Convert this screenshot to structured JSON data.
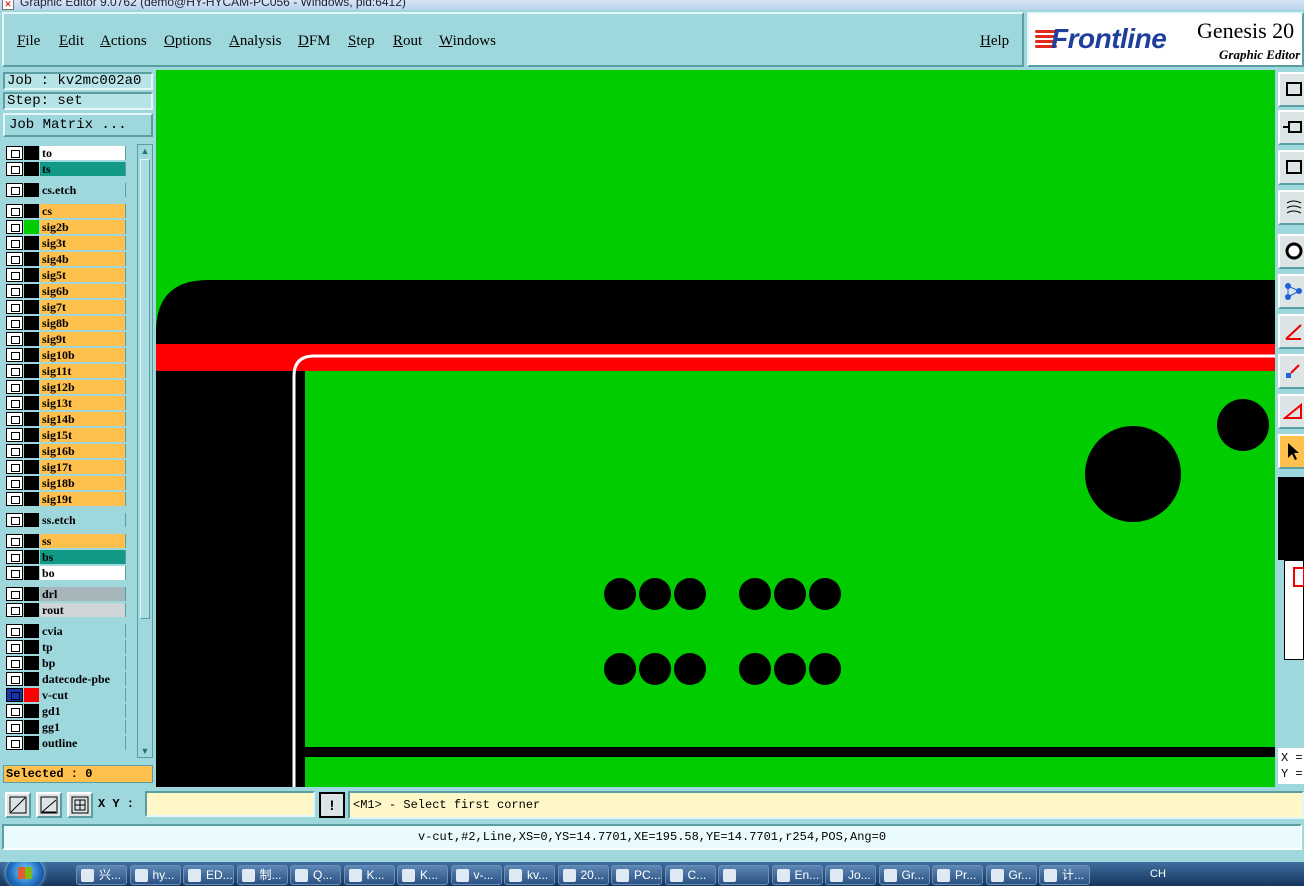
{
  "window": {
    "title": "Graphic Editor 9.0762 (demo@HY-HYCAM-PC056 - Windows, pid:6412)"
  },
  "menu": {
    "items": [
      "File",
      "Edit",
      "Actions",
      "Options",
      "Analysis",
      "DFM",
      "Step",
      "Rout",
      "Windows"
    ],
    "help": "Help"
  },
  "brand": {
    "logo": "Frontline",
    "product": "Genesis 20",
    "subtitle": "Graphic Editor"
  },
  "job": {
    "job_label": "Job : kv2mc002a0",
    "step_label": "Step: set",
    "matrix_button": "Job Matrix ..."
  },
  "layers": [
    {
      "name": "to",
      "color": "#ffffff",
      "sw": "#000000"
    },
    {
      "name": "ts",
      "color": "#129a86",
      "sw": "#000000"
    },
    {
      "name": "cs.etch",
      "color": "#9fd8dc",
      "sw": "#000000"
    },
    {
      "name": "cs",
      "color": "#ffc04d",
      "sw": "#000000"
    },
    {
      "name": "sig2b",
      "color": "#ffc04d",
      "sw": "#00cc00"
    },
    {
      "name": "sig3t",
      "color": "#ffc04d",
      "sw": "#000000"
    },
    {
      "name": "sig4b",
      "color": "#ffc04d",
      "sw": "#000000"
    },
    {
      "name": "sig5t",
      "color": "#ffc04d",
      "sw": "#000000"
    },
    {
      "name": "sig6b",
      "color": "#ffc04d",
      "sw": "#000000"
    },
    {
      "name": "sig7t",
      "color": "#ffc04d",
      "sw": "#000000"
    },
    {
      "name": "sig8b",
      "color": "#ffc04d",
      "sw": "#000000"
    },
    {
      "name": "sig9t",
      "color": "#ffc04d",
      "sw": "#000000"
    },
    {
      "name": "sig10b",
      "color": "#ffc04d",
      "sw": "#000000"
    },
    {
      "name": "sig11t",
      "color": "#ffc04d",
      "sw": "#000000"
    },
    {
      "name": "sig12b",
      "color": "#ffc04d",
      "sw": "#000000"
    },
    {
      "name": "sig13t",
      "color": "#ffc04d",
      "sw": "#000000"
    },
    {
      "name": "sig14b",
      "color": "#ffc04d",
      "sw": "#000000"
    },
    {
      "name": "sig15t",
      "color": "#ffc04d",
      "sw": "#000000"
    },
    {
      "name": "sig16b",
      "color": "#ffc04d",
      "sw": "#000000"
    },
    {
      "name": "sig17t",
      "color": "#ffc04d",
      "sw": "#000000"
    },
    {
      "name": "sig18b",
      "color": "#ffc04d",
      "sw": "#000000"
    },
    {
      "name": "sig19t",
      "color": "#ffc04d",
      "sw": "#000000"
    },
    {
      "name": "ss.etch",
      "color": "#9fd8dc",
      "sw": "#000000"
    },
    {
      "name": "ss",
      "color": "#ffc04d",
      "sw": "#000000"
    },
    {
      "name": "bs",
      "color": "#129a86",
      "sw": "#000000"
    },
    {
      "name": "bo",
      "color": "#ffffff",
      "sw": "#000000"
    },
    {
      "name": "drl",
      "color": "#a7b6ba",
      "sw": "#000000"
    },
    {
      "name": "rout",
      "color": "#d0d6d8",
      "sw": "#000000"
    },
    {
      "name": "cvia",
      "color": "#9fd8dc",
      "sw": "#000000"
    },
    {
      "name": "tp",
      "color": "#9fd8dc",
      "sw": "#000000"
    },
    {
      "name": "bp",
      "color": "#9fd8dc",
      "sw": "#000000"
    },
    {
      "name": "datecode-pbe",
      "color": "#9fd8dc",
      "sw": "#000000"
    },
    {
      "name": "v-cut",
      "color": "#9fd8dc",
      "sw": "#ff0000",
      "affected": true
    },
    {
      "name": "gd1",
      "color": "#9fd8dc",
      "sw": "#000000"
    },
    {
      "name": "gg1",
      "color": "#9fd8dc",
      "sw": "#000000"
    },
    {
      "name": "outline",
      "color": "#9fd8dc",
      "sw": "#000000"
    }
  ],
  "selected": "Selected : 0",
  "input": {
    "xy_label": "X Y :",
    "xy_value": "",
    "alert": "!"
  },
  "prompt": "<M1> - Select first corner",
  "status": "v-cut,#2,Line,XS=0,YS=14.7701,XE=195.58,YE=14.7701,r254,POS,Ang=0",
  "coords": {
    "x": "X =",
    "y": "Y ="
  },
  "taskbar": {
    "items": [
      "兴...",
      "hy...",
      "ED...",
      "制...",
      "Q...",
      "K...",
      "K...",
      "v-...",
      "kv...",
      "20...",
      "PC...",
      "C...",
      "",
      "En...",
      "Jo...",
      "Gr...",
      "Pr...",
      "Gr...",
      "计..."
    ],
    "tray": [
      "CH"
    ]
  },
  "colors": {
    "canvas": "#00cc00",
    "panel": "#9fd8dc",
    "accent": "#ffc04d",
    "vcut": "#ff0000"
  }
}
